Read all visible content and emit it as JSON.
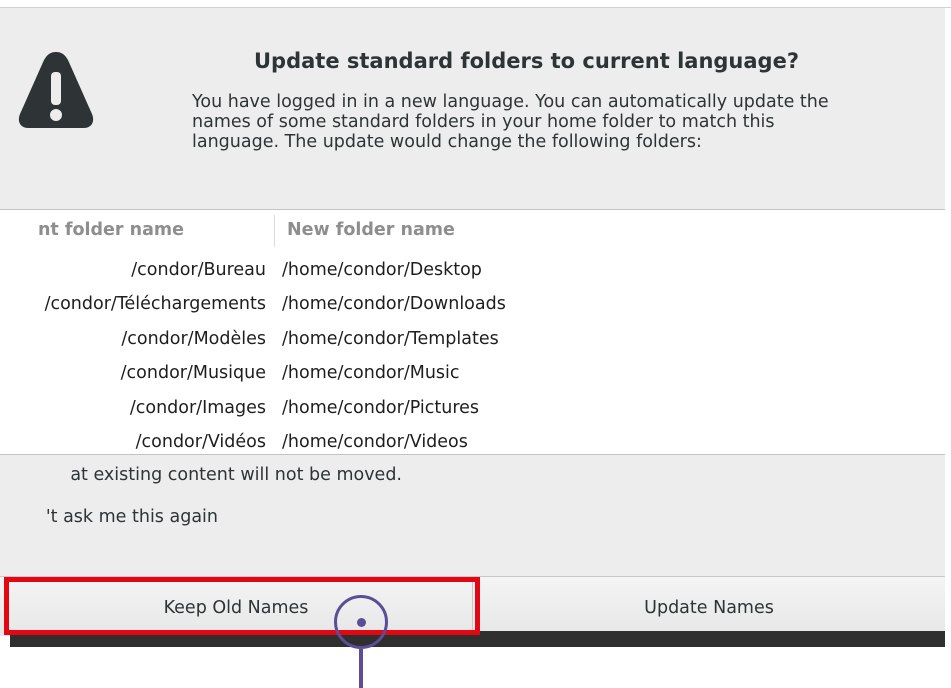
{
  "dialog": {
    "title": "Update standard folders to current language?",
    "message": "You have logged in in a new language. You can automatically update the\nnames of some standard folders in your home folder to match this\nlanguage. The update would change the following folders:",
    "icon": "warning-icon",
    "table": {
      "headers": {
        "current": "nt folder name",
        "new": "New folder name"
      },
      "rows": [
        {
          "current": "/condor/Bureau",
          "new": "/home/condor/Desktop"
        },
        {
          "current": "/condor/Téléchargements",
          "new": "/home/condor/Downloads"
        },
        {
          "current": "/condor/Modèles",
          "new": "/home/condor/Templates"
        },
        {
          "current": "/condor/Musique",
          "new": "/home/condor/Music"
        },
        {
          "current": "/condor/Images",
          "new": "/home/condor/Pictures"
        },
        {
          "current": "/condor/Vidéos",
          "new": "/home/condor/Videos"
        }
      ]
    },
    "note": "at existing content will not be moved.",
    "dont_ask_label": "'t ask me this again",
    "buttons": {
      "keep": "Keep Old Names",
      "update": "Update Names"
    }
  },
  "colors": {
    "highlight": "#e30613",
    "cursor": "#5b4e96",
    "warning_icon": "#2e3436"
  }
}
